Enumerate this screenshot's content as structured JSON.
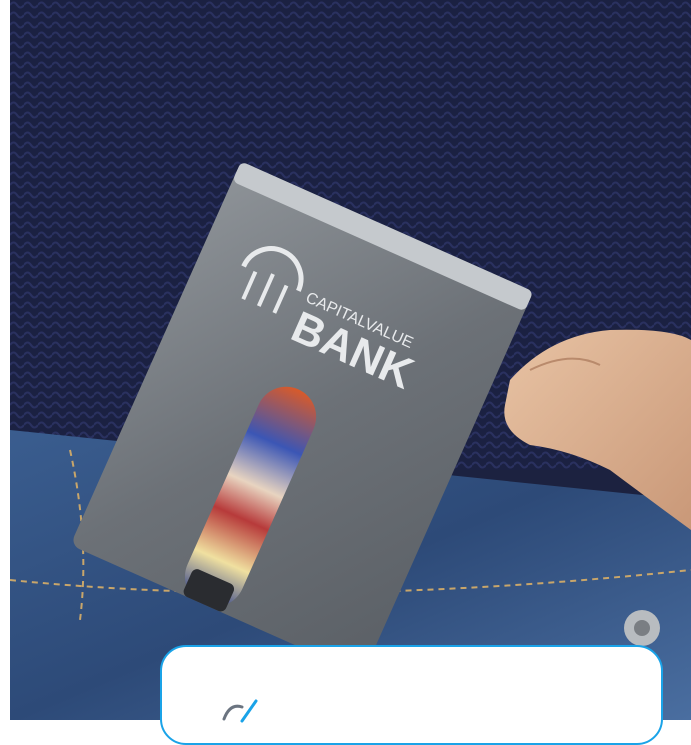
{
  "image": {
    "description_icon": "rfid-card-holder-photo",
    "brand_small": "CAPITALVALUE",
    "brand_large": "BANK"
  },
  "badge": {
    "icon": "check-icon",
    "accent_color": "#1aa3e8"
  }
}
